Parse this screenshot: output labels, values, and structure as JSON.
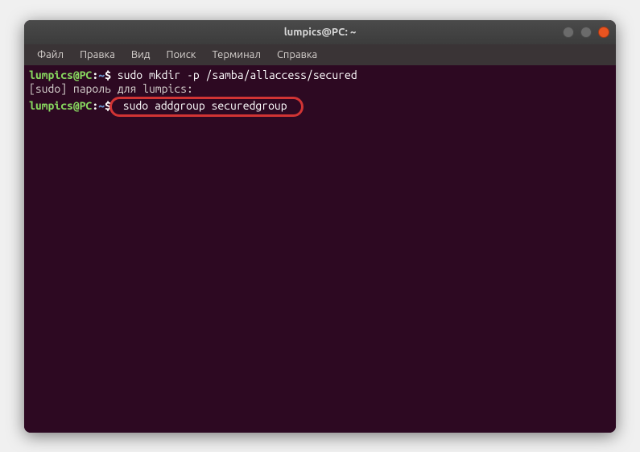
{
  "titlebar": {
    "title": "lumpics@PC: ~"
  },
  "menu": {
    "file": "Файл",
    "edit": "Правка",
    "view": "Вид",
    "search": "Поиск",
    "terminal": "Терминал",
    "help": "Справка"
  },
  "prompt": {
    "user_host": "lumpics@PC",
    "colon": ":",
    "path": "~",
    "dollar": "$"
  },
  "lines": {
    "cmd1": " sudo mkdir -p /samba/allaccess/secured",
    "out1": "[sudo] пароль для lumpics:",
    "cmd2": " sudo addgroup securedgroup "
  }
}
